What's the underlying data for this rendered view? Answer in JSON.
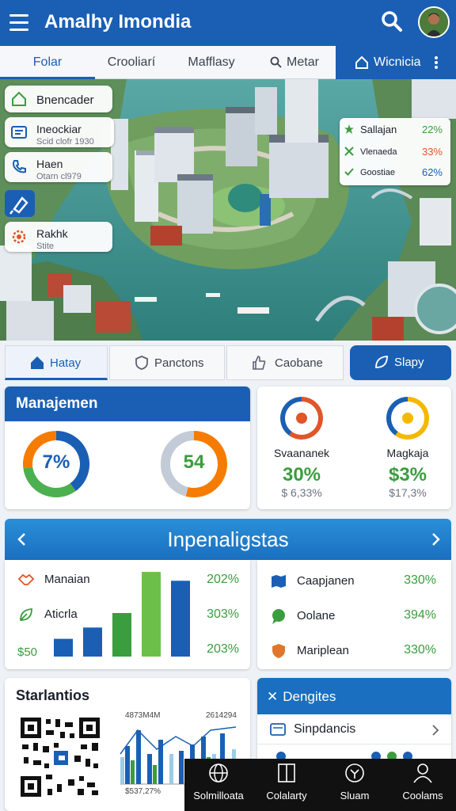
{
  "header": {
    "title": "Amalhy Imondia",
    "menu_icon": "hamburger-menu-icon",
    "search_icon": "search-icon",
    "avatar": "user-avatar"
  },
  "top_tabs": [
    "Folar",
    "Crooliarí",
    "Mafflasy",
    "Metar"
  ],
  "top_tab_action": "Wicnicia",
  "map": {
    "chips": [
      {
        "title": "Bnencader",
        "sub": "",
        "icon": "home-icon"
      },
      {
        "title": "Ineockiar",
        "sub": "Scid clofr 1930",
        "icon": "id-card-icon"
      },
      {
        "title": "Haen",
        "sub": "Otarn cl979",
        "icon": "phone-icon"
      },
      {
        "title": "Rakhk",
        "sub": "Stite",
        "icon": "gear-icon"
      }
    ],
    "pin_icon": "pin-tool-icon",
    "stats": [
      {
        "label": "Sallajan",
        "value": "22%",
        "color": "#3a9d3e"
      },
      {
        "label": "Vlenaeda",
        "value": "33%",
        "color": "#e0562b"
      },
      {
        "label": "Goostiae",
        "value": "62%",
        "color": "#1a5fb4"
      }
    ]
  },
  "section_tabs": [
    "Hatay",
    "Panctons",
    "Caobane",
    "Slapy"
  ],
  "management": {
    "title": "Manajemen",
    "donuts": [
      {
        "value_text": "7%",
        "text_color": "#1a5fb4",
        "segments": [
          {
            "f": 0.4,
            "c": "#1a5fb4"
          },
          {
            "f": 0.33,
            "c": "#4caf50"
          },
          {
            "f": 0.27,
            "c": "#f57c00"
          }
        ]
      },
      {
        "value_text": "54",
        "text_color": "#3a9d3e",
        "segments": [
          {
            "f": 0.54,
            "c": "#f57c00"
          },
          {
            "f": 0.46,
            "c": "#c2cbd6"
          }
        ]
      }
    ]
  },
  "gauges": [
    {
      "label": "Svaananek",
      "value": "30%",
      "sub": "$ 6,33%",
      "ring": [
        "#e0562b",
        "#1a5fb4"
      ],
      "icon": "location-pin-icon"
    },
    {
      "label": "Magkaja",
      "value": "$3%",
      "sub": "$17,3%",
      "ring": [
        "#f5b800",
        "#1a5fb4"
      ],
      "icon": "trophy-icon"
    }
  ],
  "insights": {
    "title": "Inpenaligstas",
    "left_rows": [
      {
        "label": "Manaian",
        "icon": "handshake-icon"
      },
      {
        "label": "Aticrla",
        "icon": "leaf-icon"
      },
      {
        "label": "$50",
        "icon": ""
      }
    ],
    "percents_left": [
      "202%",
      "303%",
      "203%"
    ],
    "bar_chart": [
      {
        "value": 22,
        "color": "#1a5fb4"
      },
      {
        "value": 36,
        "color": "#1a5fb4"
      },
      {
        "value": 54,
        "color": "#3a9d3e"
      },
      {
        "value": 105,
        "color": "#6cc04a"
      },
      {
        "value": 94,
        "color": "#1a5fb4"
      }
    ],
    "right_rows": [
      {
        "label": "Caapjanen",
        "value": "330%",
        "icon": "map-icon"
      },
      {
        "label": "Oolane",
        "value": "394%",
        "icon": "chat-bubble-icon"
      },
      {
        "label": "Mariplean",
        "value": "330%",
        "icon": "shield-icon"
      }
    ]
  },
  "statistics": {
    "title": "Starlantios",
    "chart_label_left": "4873M4M",
    "chart_label_right": "2614294",
    "chart_label_bottom": "$537,27%"
  },
  "dengites": {
    "title": "Dengites",
    "close_icon": "close-icon",
    "item": "Sinpdancis",
    "item_icon": "card-icon"
  },
  "bottom_nav": [
    {
      "label": "Solmilloata",
      "icon": "globe-icon"
    },
    {
      "label": "Colalarty",
      "icon": "columns-icon"
    },
    {
      "label": "Sluam",
      "icon": "clock-icon"
    },
    {
      "label": "Coolams",
      "icon": "person-icon"
    }
  ]
}
